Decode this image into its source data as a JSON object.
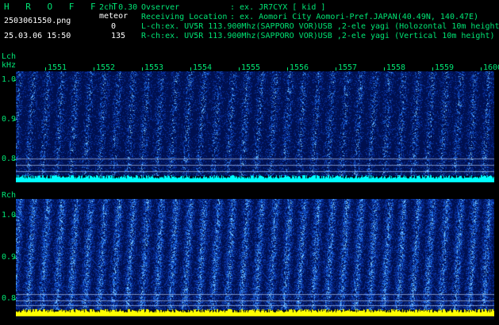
{
  "header": {
    "logo": "H R O F F T",
    "version": "2ch 0.30",
    "filename": "2503061550.png",
    "mode": "meteor",
    "datetime": "25.03.06 15:50",
    "count_l": "0",
    "count_r": "135",
    "observer_label": "Ovserver",
    "observer_value": ": ex. JR7CYX [ kid ]",
    "location_label": "Receiving Location",
    "location_value": ": ex. Aomori City Aomori-Pref.JAPAN(40.49N, 140.47E)",
    "lch_line": "L-ch:ex. UV5R 113.900Mhz(SAPPORO VOR)USB ,2-ele yagi (Holozontal 10m height",
    "rch_line": "R-ch:ex. UV5R 113.900Mhz(SAPPORO VOR)USB ,2-ele yagi (Vertical 10m height)"
  },
  "lch_panel": {
    "channel_label": "Lch",
    "unit_label": "kHz",
    "time_labels": [
      "1551",
      "1552",
      "1553",
      "1554",
      "1555",
      "1556",
      "1557",
      "1558",
      "1559",
      "1600"
    ],
    "freq_labels": [
      "1.0",
      "0.9",
      "0.8"
    ]
  },
  "rch_panel": {
    "channel_label": "Rch",
    "freq_labels": [
      "1.0",
      "0.9",
      "0.8"
    ]
  },
  "colors": {
    "text_green": "#00e676",
    "text_white": "#ffffff",
    "noise_dark": "#00205a",
    "noise_bright": "#3ab0ff",
    "strip_l": "#00ffff",
    "strip_r": "#ffff00"
  }
}
